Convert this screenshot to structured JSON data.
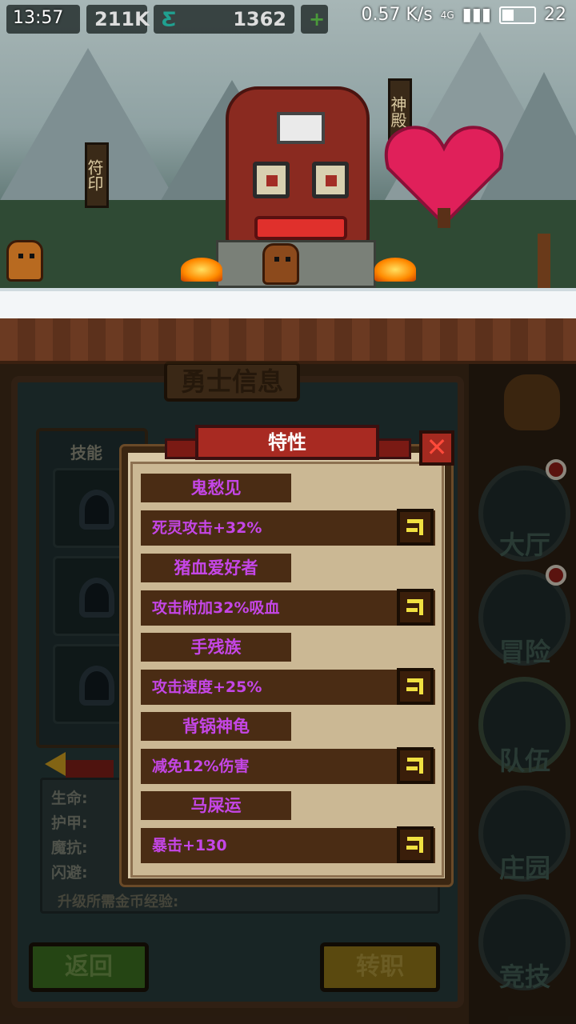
{
  "status_bar": {
    "time": "13:57",
    "resource_1": "211K",
    "resource_2": "1362",
    "network_speed": "0.57 K/s",
    "network_type": "4G",
    "battery": "22"
  },
  "scene": {
    "sign_left": "符印",
    "sign_right": "神殿"
  },
  "hero_panel": {
    "title": "勇士信息",
    "skills_label": "技能",
    "stats": [
      {
        "label": "生命:"
      },
      {
        "label": "护甲:"
      },
      {
        "label": "魔抗:"
      },
      {
        "label": "闪避:"
      }
    ],
    "exp_label": "升级所需金币经验:",
    "back_button": "返回",
    "job_button": "转职"
  },
  "nav": {
    "items": [
      {
        "label": "大厅",
        "badge": true
      },
      {
        "label": "冒险",
        "badge": true
      },
      {
        "label": "队伍",
        "badge": false
      },
      {
        "label": "庄园",
        "badge": false
      },
      {
        "label": "竞技",
        "badge": false
      }
    ]
  },
  "dialog": {
    "title": "特性",
    "close_label": "✕",
    "traits": [
      {
        "name": "鬼愁见",
        "effect": "死灵攻击+32%"
      },
      {
        "name": "猪血爱好者",
        "effect": "攻击附加32%吸血"
      },
      {
        "name": "手残族",
        "effect": "攻击速度+25%"
      },
      {
        "name": "背锅神龟",
        "effect": "减免12%伤害"
      },
      {
        "name": "马屎运",
        "effect": "暴击+130"
      }
    ]
  },
  "colors": {
    "trait_text": "#c446e6",
    "ribbon": "#a82a22",
    "trait_button_icon": "#f0e040"
  }
}
